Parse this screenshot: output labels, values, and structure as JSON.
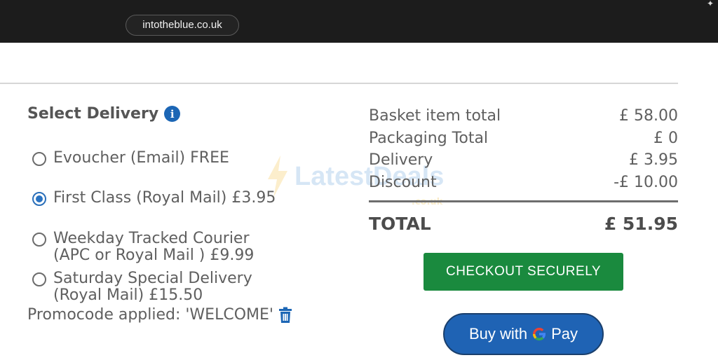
{
  "browser": {
    "url": "intotheblue.co.uk"
  },
  "delivery": {
    "heading": "Select Delivery",
    "info_icon_glyph": "i",
    "options": [
      {
        "line1": "Evoucher (Email) FREE",
        "line2": "",
        "selected": false
      },
      {
        "line1": "First Class (Royal Mail) £3.95",
        "line2": "",
        "selected": true
      },
      {
        "line1": "Weekday Tracked Courier",
        "line2": "(APC or Royal Mail ) £9.99",
        "selected": false
      },
      {
        "line1": "Saturday Special Delivery",
        "line2": "(Royal Mail) £15.50",
        "selected": false
      }
    ],
    "promo_text": "Promocode applied: 'WELCOME'"
  },
  "summary": {
    "rows": [
      {
        "label": "Basket item total",
        "value": "£ 58.00"
      },
      {
        "label": "Packaging Total",
        "value": "£ 0"
      },
      {
        "label": "Delivery",
        "value": "£ 3.95"
      },
      {
        "label": "Discount",
        "value": "-£ 10.00"
      }
    ],
    "total_label": "TOTAL",
    "total_value": "£ 51.95"
  },
  "buttons": {
    "checkout_label": "CHECKOUT SECURELY",
    "gpay_prefix": "Buy with",
    "gpay_suffix": "Pay"
  },
  "watermark": {
    "text": "LatestDeals",
    "sub": ".co.uk"
  },
  "colors": {
    "accent_blue": "#1c66b5",
    "checkout_green": "#1a8a3e",
    "gpay_blue": "#1f63b4",
    "topbar": "#1c1c1c"
  },
  "icons": [
    "info-icon",
    "trash-icon",
    "google-g-icon",
    "lightning-icon"
  ]
}
